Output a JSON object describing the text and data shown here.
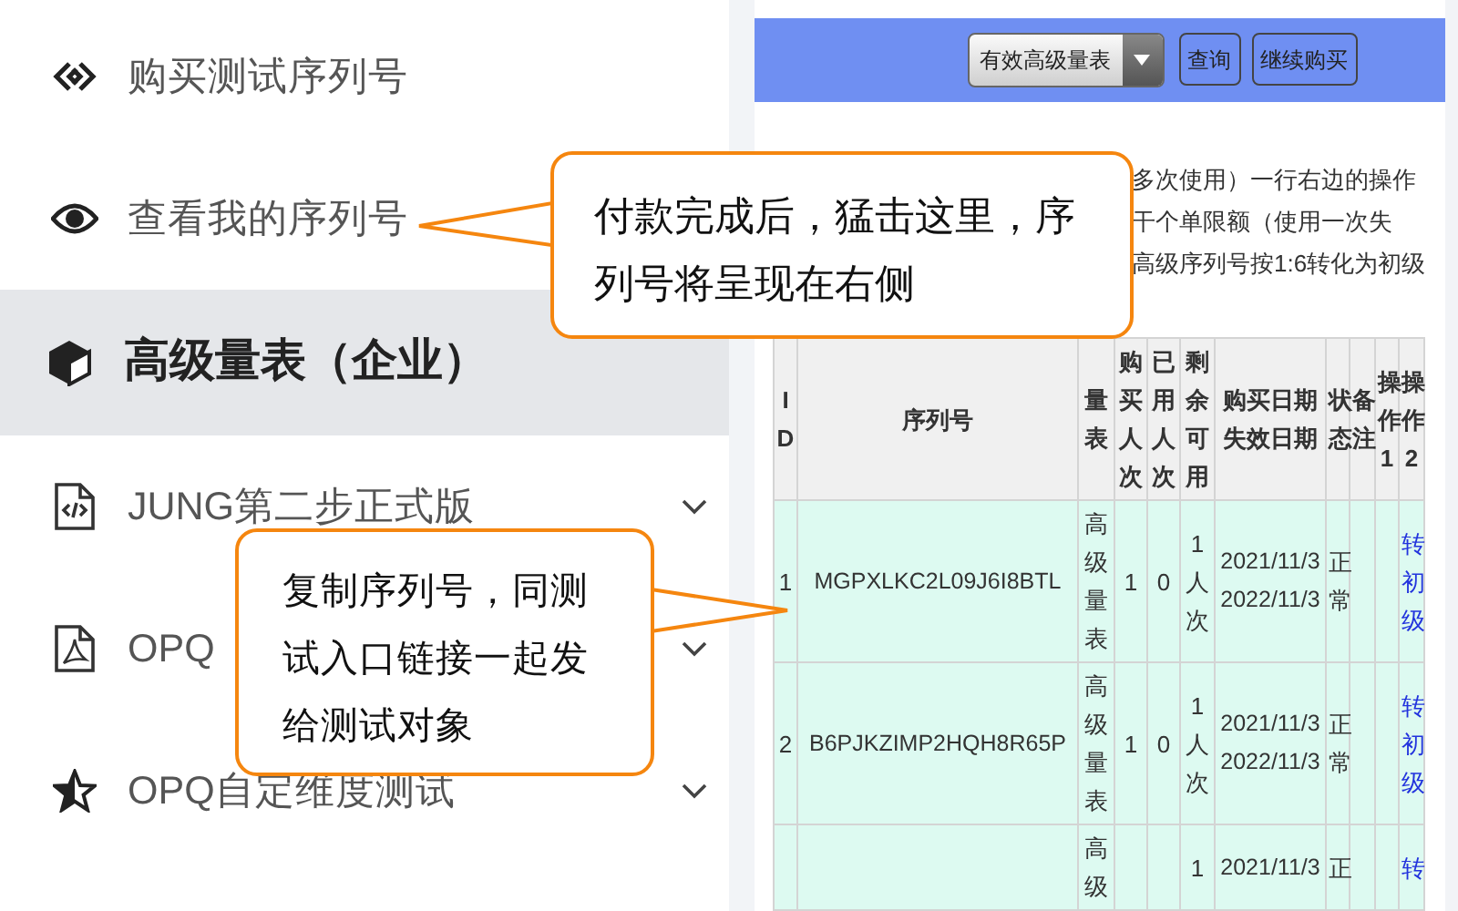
{
  "sidebar": {
    "items": [
      {
        "label": "购买测试序列号",
        "selected": false,
        "expandable": false
      },
      {
        "label": "查看我的序列号",
        "selected": false,
        "expandable": false
      },
      {
        "label": "高级量表（企业）",
        "selected": true,
        "expandable": false
      },
      {
        "label": "JUNG第二步正式版",
        "selected": false,
        "expandable": true
      },
      {
        "label": "OPQ",
        "selected": false,
        "expandable": true
      },
      {
        "label": "OPQ自定维度测试",
        "selected": false,
        "expandable": true
      }
    ]
  },
  "toolbar": {
    "filter": {
      "value": "有效高级量表"
    },
    "buttons": [
      "查询",
      "继续购买"
    ]
  },
  "notice": [
    "多次使用）一行右边的操作",
    "干个单限额（使用一次失",
    "高级序列号按1:6转化为初级"
  ],
  "table": {
    "columns": [
      "ID",
      "序列号",
      "量表",
      "购买人次",
      "已用人次",
      "剩余可用",
      "购买日期失效日期",
      "状态",
      "备注",
      "操作1",
      "操作2"
    ],
    "rows": [
      {
        "id": "1",
        "serial": "MGPXLKC2L09J6I8BTL",
        "scale": "高级量表",
        "bought": "1",
        "used": "0",
        "remaining": "1人次",
        "dates": "2021/11/3\n2022/11/3",
        "status": "正常",
        "action": "转初级"
      },
      {
        "id": "2",
        "serial": "B6PJKZIMP2HQH8R65P",
        "scale": "高级量表",
        "bought": "1",
        "used": "0",
        "remaining": "1人次",
        "dates": "2021/11/3\n2022/11/3",
        "status": "正常",
        "action": "转初级"
      },
      {
        "scale": "高级",
        "remaining": "1",
        "dates": "2021/11/3",
        "status": "正",
        "action": "转"
      }
    ]
  },
  "callouts": [
    {
      "text": "付款完成后，猛击这里，序列号将呈现在右侧"
    },
    {
      "text": "复制序列号，同测试入口链接一起发给测试对象"
    }
  ]
}
